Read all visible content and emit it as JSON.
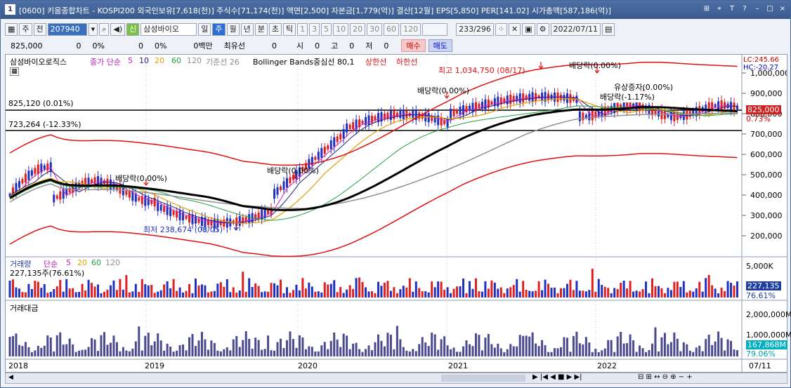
{
  "window": {
    "number": "1",
    "title": "[0600] 키움종합차트 - KOSPI200 외국인보유[7,618(천)] 주식수[71,174(천)] 액면[2,500] 자본금[1,779(억)] 결산[12월] EPS[5,850] PER[141.02] 시가총액[587,186(억)]"
  },
  "toolbar": {
    "period_day": "주",
    "prev": "전",
    "code": "207940",
    "name": "삼성바이오",
    "tf": [
      "일",
      "주",
      "월",
      "년",
      "분",
      "초",
      "틱"
    ],
    "nums": [
      "1",
      "3",
      "5",
      "10",
      "20",
      "30",
      "60",
      "120"
    ],
    "count": "233/296",
    "date": "2022/07/11"
  },
  "quote": {
    "price": "825,000",
    "chg": "0",
    "chg_pct": "0%",
    "v1": "0",
    "v1_pct": "0%",
    "amount": "0백만",
    "best": "최유선",
    "v2": "0",
    "open_l": "시",
    "open_v": "0",
    "high_l": "고",
    "high_v": "0",
    "low_l": "저",
    "low_v": "0",
    "buy": "매수",
    "sell": "매도"
  },
  "price_panel": {
    "stock_label": "삼성바이오로직스",
    "ma_label": "종가 단순",
    "ma": [
      "5",
      "10",
      "20",
      "60",
      "120"
    ],
    "ichimoku": "기준선 26",
    "bb": "Bollinger Bands중심선 80,1",
    "upper": "상한선",
    "lower": "하한선",
    "lc": "LC:245.66",
    "hc": "HC:-20.27",
    "line1": "825,120 (0.01%)",
    "line2": "723,264 (-12.33%)",
    "current": "825,000",
    "current_pct": "0.73%",
    "high_note": "최고 1,034,750 (08/17)",
    "low_note": "최저 238,674 (08/05)",
    "ann1": "배당락(0.00%)",
    "ann2": "배당락(0.00%)",
    "ann3": "배당락(0.00%)",
    "ann4": "배당락(0.00%)",
    "ann5": "유상증자(0.00%)",
    "ann6": "배당락(-1.17%)",
    "yticks": [
      "1,000,000",
      "900,000",
      "800,000",
      "700,000",
      "600,000",
      "500,000",
      "400,000",
      "300,000",
      "200,000"
    ]
  },
  "volume_panel": {
    "label": "거래량",
    "ma_label": "단순",
    "ma": [
      "5",
      "20",
      "60",
      "120"
    ],
    "value": "227,135주(76.61%)",
    "ytick": "5,000K",
    "current": "227,135",
    "current_pct": "76.61%"
  },
  "amount_panel": {
    "label": "거래대금",
    "yticks": [
      "2,000,000M",
      "1,000,000M"
    ],
    "current": "167,868M",
    "current_pct": "79.06%"
  },
  "xaxis": [
    "2018",
    "2019",
    "2020",
    "2021",
    "2022",
    "07/11"
  ],
  "colors": {
    "up": "#e02020",
    "down": "#2030c0",
    "ma5": "#e020c0",
    "ma10": "#202080",
    "ma20": "#e0a000",
    "ma60": "#20a040",
    "ma120": "#909090",
    "bb_mid": "#000000",
    "bb_band": "#e01010"
  }
}
